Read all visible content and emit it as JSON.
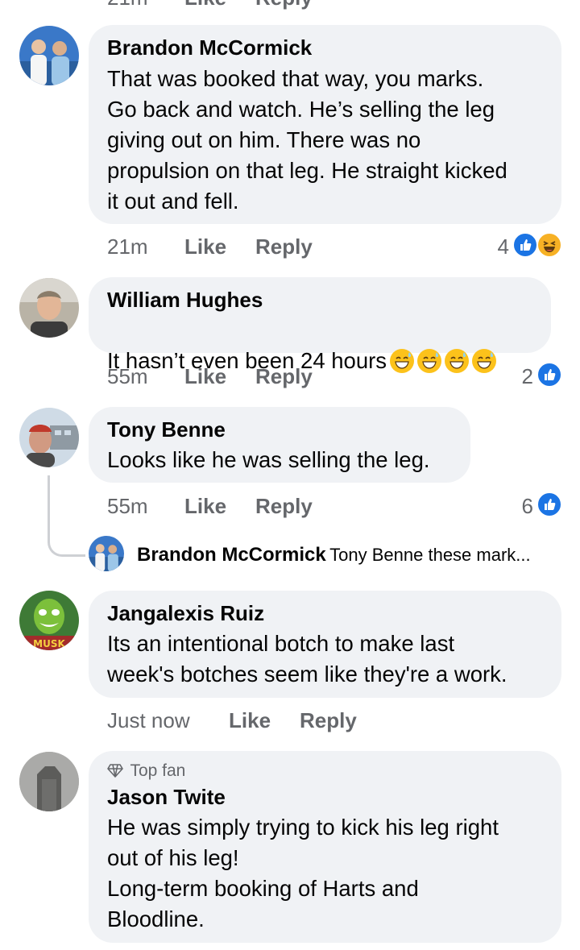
{
  "top_partial": {
    "time": "21m",
    "like": "Like",
    "reply": "Reply"
  },
  "comments": [
    {
      "author": "Brandon McCormick",
      "text": "That was booked that way, you marks.\nGo back and watch. He’s selling the leg\ngiving out on him. There was no\npropulsion on that leg. He straight kicked\nit out and fell.",
      "time": "21m",
      "like": "Like",
      "reply": "Reply",
      "reactions": "4"
    },
    {
      "author": "William Hughes",
      "text": "It hasn’t even been 24 hours",
      "time": "55m",
      "like": "Like",
      "reply": "Reply",
      "reactions": "2"
    },
    {
      "author": "Tony Benne",
      "text": "Looks like he was selling the leg.",
      "time": "55m",
      "like": "Like",
      "reply": "Reply",
      "reactions": "6"
    },
    {
      "author": "Jangalexis Ruiz",
      "text": "Its an intentional botch to make last\nweek's botches seem like they're a work.",
      "time": "Just now",
      "like": "Like",
      "reply": "Reply"
    },
    {
      "badge": "Top fan",
      "author": "Jason Twite",
      "text": "He was simply trying to kick his leg right\nout of his leg!\nLong-term booking of Harts and\nBloodline."
    }
  ],
  "reply_preview": {
    "author": "Brandon McCormick",
    "text": "Tony Benne these mark..."
  },
  "colors": {
    "bubble": "#f0f2f5",
    "meta_text": "#65676b",
    "like_blue": "#1b74e4",
    "haha_yellow": "#f7b125"
  },
  "icons": [
    "like-reaction-icon",
    "haha-reaction-icon",
    "sweat-smile-emoji-icon",
    "top-fan-diamond-icon"
  ]
}
